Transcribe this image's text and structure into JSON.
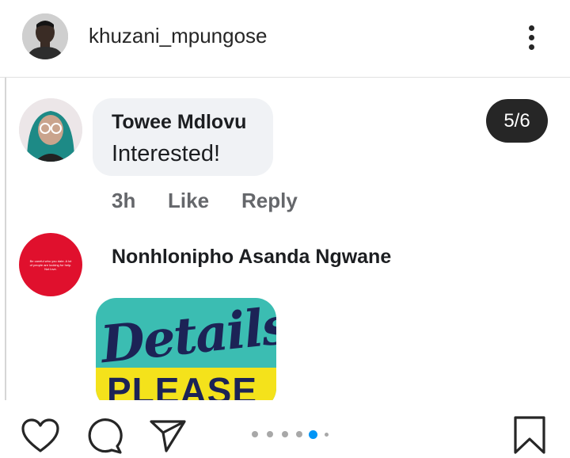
{
  "header": {
    "username": "khuzani_mpungose",
    "avatar": "profile-photo",
    "more_icon": "more-vertical-icon"
  },
  "post": {
    "counter": "5/6",
    "comments": [
      {
        "author": "Towee Mdlovu",
        "text": "Interested!",
        "time": "3h",
        "like": "Like",
        "reply": "Reply",
        "avatar": "cartoon-girl-avatar"
      },
      {
        "author": "Nonhlonipho Asanda Ngwane",
        "avatar_text": "Be careful who you date. A lot of people are looking for help. Not love.",
        "sticker_text": "Details",
        "sticker_text2": "PLEASE"
      }
    ]
  },
  "actions": {
    "like_icon": "heart-icon",
    "comment_icon": "comment-icon",
    "share_icon": "send-icon",
    "save_icon": "bookmark-icon",
    "carousel": {
      "total": 6,
      "active_index": 4
    }
  },
  "colors": {
    "accent": "#0095f6",
    "text": "#262626",
    "badge_bg": "#262626",
    "bubble_bg": "#f0f2f5",
    "sticker_bg": "#3bbdb2",
    "sticker_band": "#f4e21b",
    "avatar2_bg": "#e0102d"
  }
}
